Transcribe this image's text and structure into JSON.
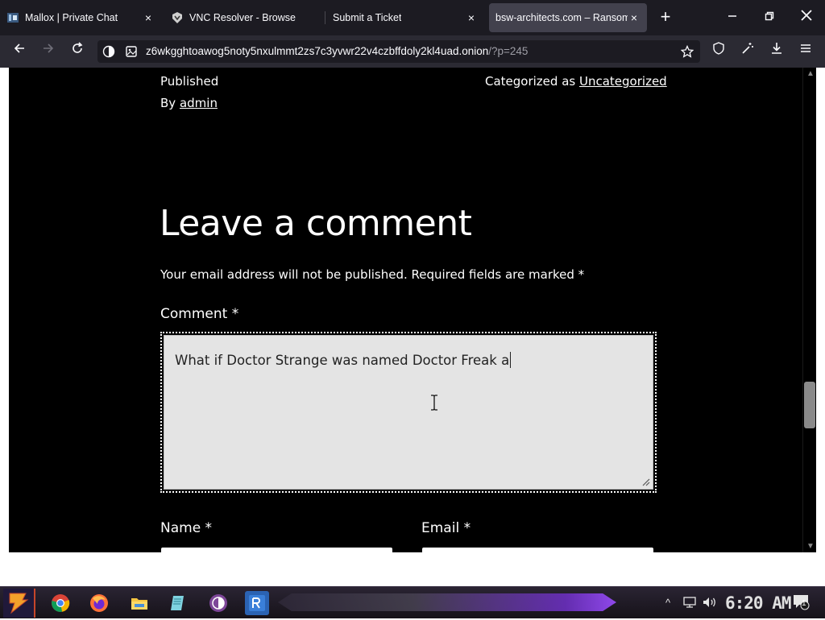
{
  "browser": {
    "tabs": [
      {
        "title": "Mallox | Private Chat",
        "close": "×",
        "active": false
      },
      {
        "title": "VNC Resolver - Browse",
        "close": "",
        "active": false
      },
      {
        "title": "Submit a Ticket",
        "close": "×",
        "active": false
      },
      {
        "title": "bsw-architects.com – Ransom",
        "close": "×",
        "active": true
      }
    ],
    "new_tab_label": "+",
    "url_host": "z6wkgghtoawog5noty5nxulmmt2zs7c3yvwr22v4czbffdoly2kl4uad.onion",
    "url_path": "/?p=245",
    "icons": {
      "back": "arrow-left-icon",
      "forward": "arrow-right-icon",
      "reload": "reload-icon",
      "onion": "onion-icon",
      "page_info": "page-icon",
      "bookmark": "star-icon",
      "shield": "shield-icon",
      "extension": "wand-icon",
      "downloads": "download-icon",
      "menu": "hamburger-icon"
    }
  },
  "page": {
    "published_label": "Published",
    "by_prefix": "By",
    "author": "admin",
    "categorized_prefix": "Categorized as",
    "category": "Uncategorized",
    "heading": "Leave a comment",
    "email_note": "Your email address will not be published. Required fields are marked *",
    "comment_label": "Comment *",
    "comment_value": "What if Doctor Strange was named Doctor Freak a",
    "name_label": "Name *",
    "email_label": "Email *"
  },
  "taskbar": {
    "apps": [
      "start-icon",
      "chrome-icon",
      "firefox-icon",
      "file-explorer-icon",
      "notepad-icon",
      "tor-icon",
      "rdp-icon"
    ],
    "clock": "6:20 AM",
    "notification_count": "1"
  },
  "colors": {
    "page_bg": "#000000",
    "tab_bar": "#1c1b22",
    "nav_bar": "#2b2a33",
    "active_tab": "#42414d",
    "textarea_bg": "#e4e4e4",
    "taskbar_accent": "#9b4dff"
  }
}
